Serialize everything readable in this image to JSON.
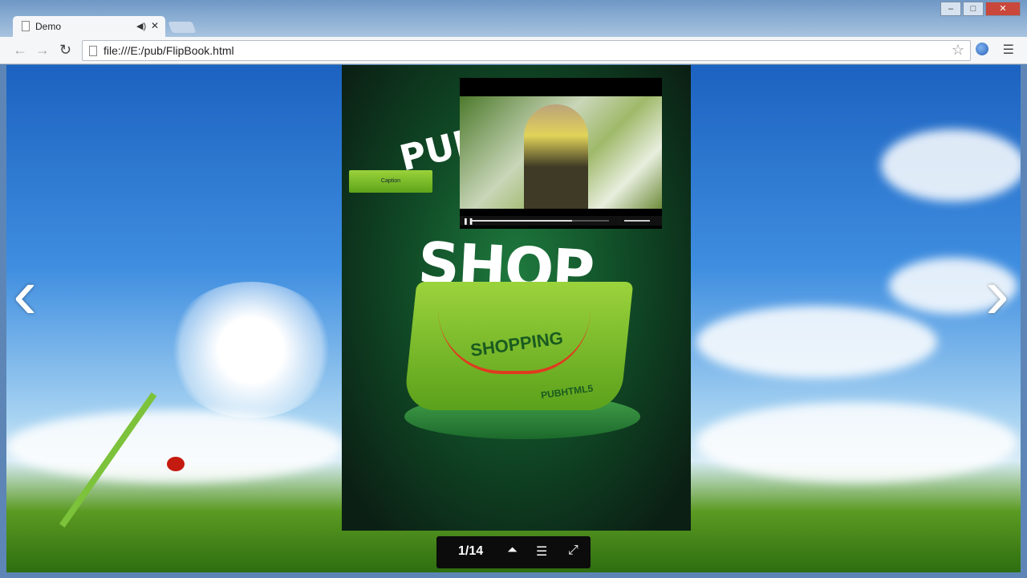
{
  "browser": {
    "tab_title": "Demo",
    "url": "file:///E:/pub/FlipBook.html"
  },
  "flipbook": {
    "caption_button": "Caption",
    "page_title_partial": "PUB",
    "cover_headline": "SHOP",
    "bag_text": "SHOPPING",
    "brand_text": "PUBHTML5",
    "video_progress": 0.73,
    "page_indicator": "1/14"
  }
}
